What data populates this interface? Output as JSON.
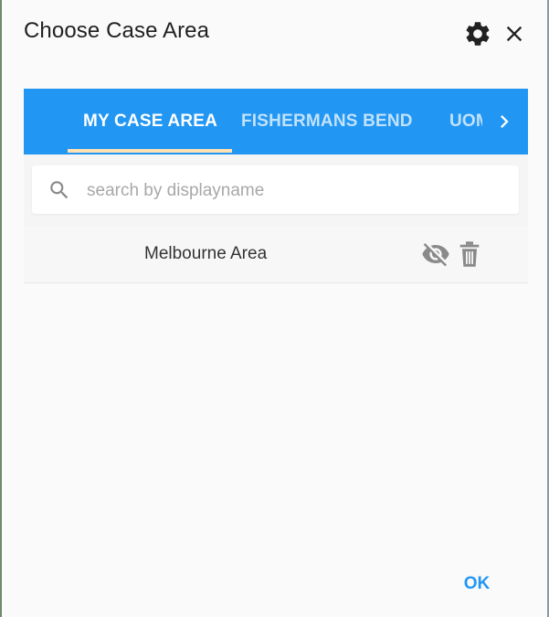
{
  "dialog": {
    "title": "Choose Case Area",
    "icons": {
      "settings": "gear-icon",
      "close": "close-icon"
    }
  },
  "tabs": {
    "items": [
      {
        "label": "MY CASE AREA",
        "active": true
      },
      {
        "label": "FISHERMANS BEND",
        "active": false
      },
      {
        "label": "UOM",
        "active": false
      }
    ],
    "next_icon": "chevron-right-icon",
    "indicator_color": "#ffe0b2",
    "bar_color": "#2196f3"
  },
  "search": {
    "placeholder": "search by displayname",
    "value": ""
  },
  "list": {
    "items": [
      {
        "label": "Melbourne Area",
        "actions": [
          "visibility-off-icon",
          "delete-icon"
        ]
      }
    ]
  },
  "footer": {
    "ok_label": "OK",
    "accent": "#2196f3"
  }
}
